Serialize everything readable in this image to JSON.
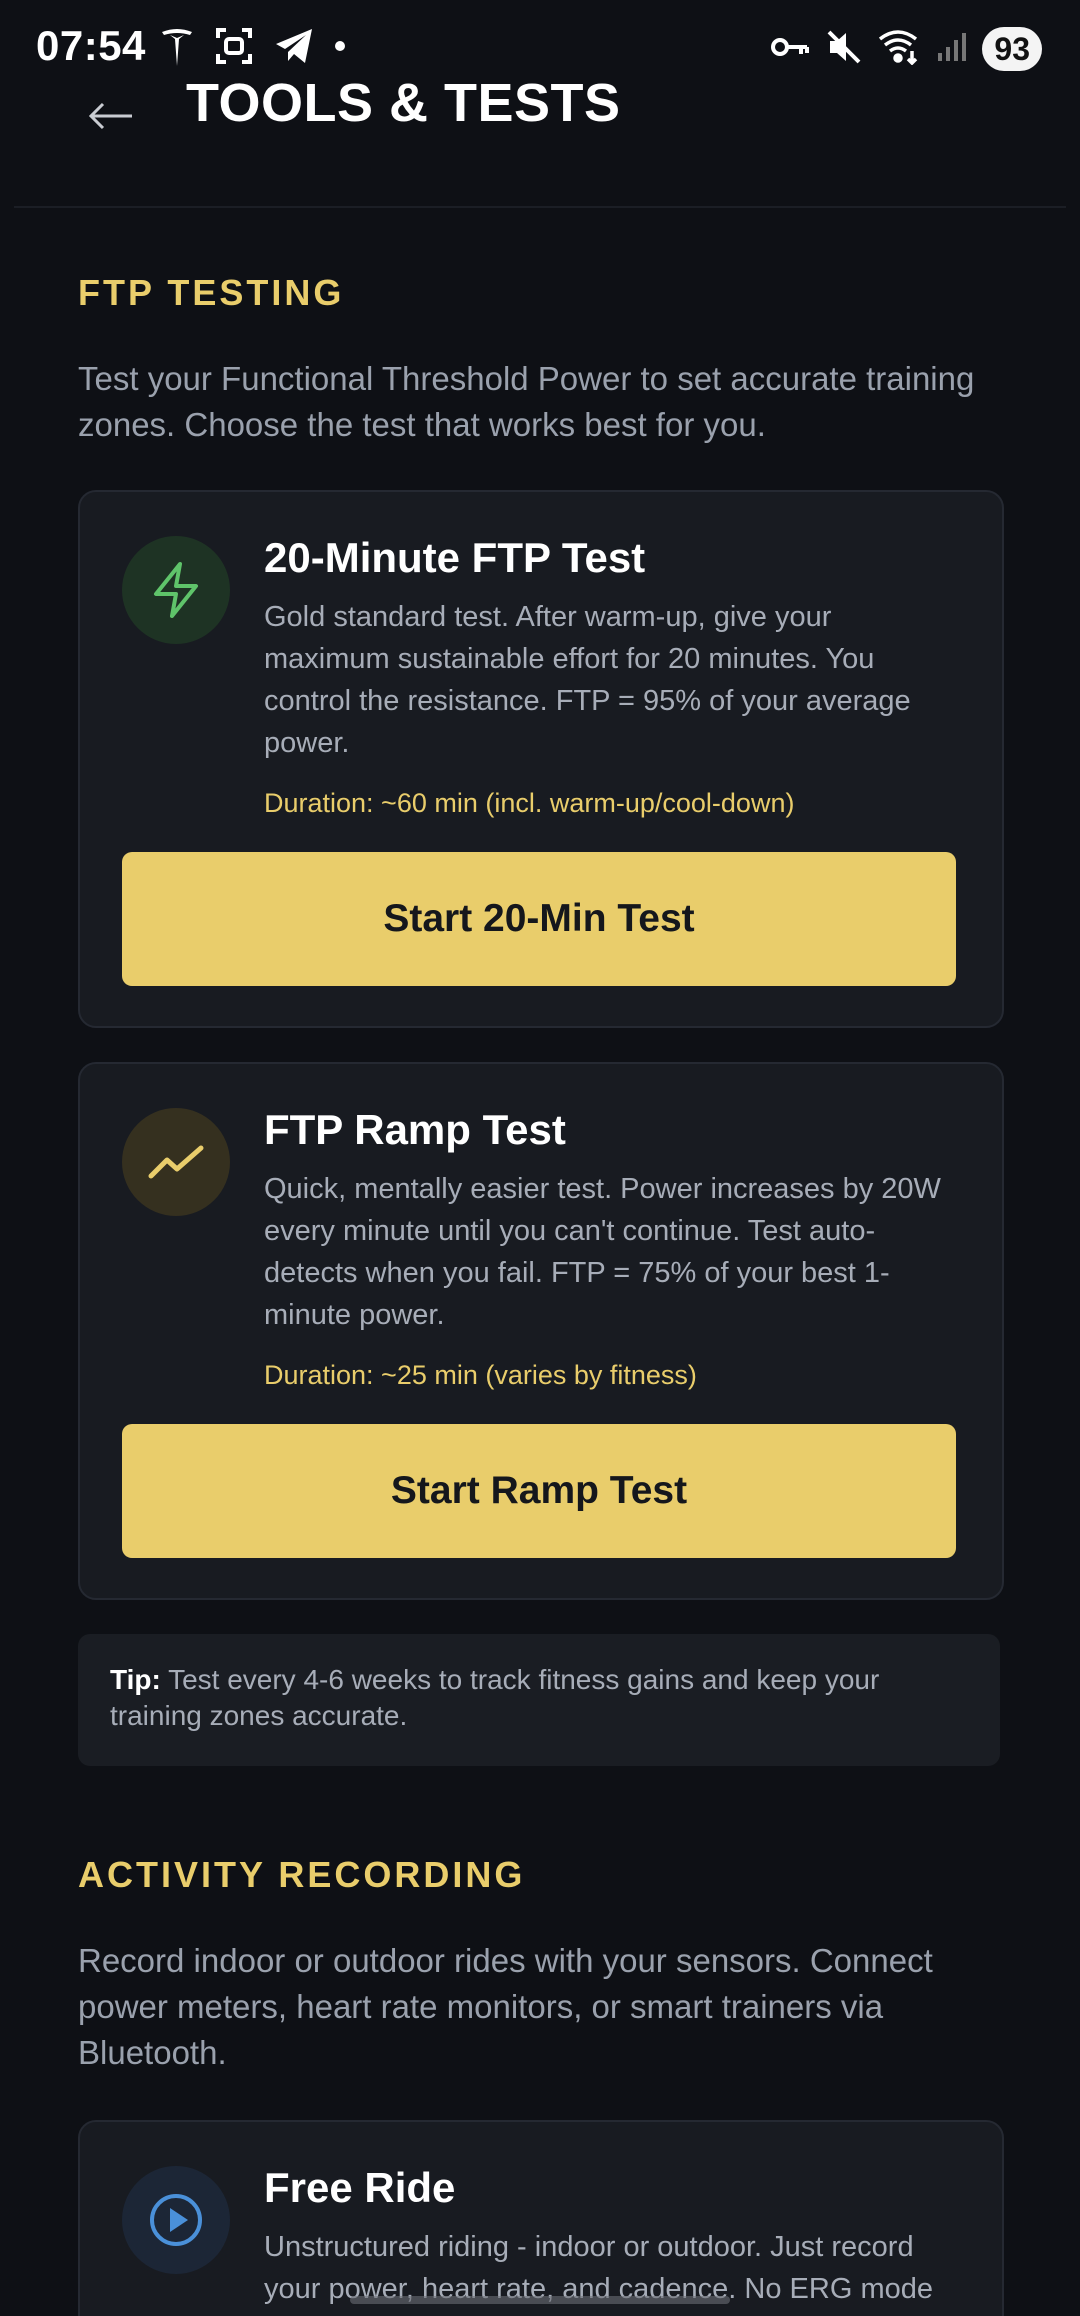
{
  "status_bar": {
    "time": "07:54",
    "battery": "93",
    "left_icons": [
      "tesla-icon",
      "face-scan-icon",
      "telegram-icon",
      "dot-icon"
    ],
    "right_icons": [
      "vpn-key-icon",
      "mute-icon",
      "wifi-icon",
      "signal-icon"
    ]
  },
  "header": {
    "title": "TOOLS & TESTS",
    "back_icon": "arrow-left-icon"
  },
  "ftp_section": {
    "title": "FTP TESTING",
    "description": "Test your Functional Threshold Power to set accurate training zones. Choose the test that works best for you.",
    "cards": [
      {
        "icon": "lightning-icon",
        "icon_color": "#5fc46a",
        "title": "20-Minute FTP Test",
        "description": "Gold standard test. After warm-up, give your maximum sustainable effort for 20 minutes. You control the resistance. FTP = 95% of your average power.",
        "duration": "Duration: ~60 min (incl. warm-up/cool-down)",
        "button_label": "Start 20-Min Test"
      },
      {
        "icon": "trend-up-icon",
        "icon_color": "#e9cd6b",
        "title": "FTP Ramp Test",
        "description": "Quick, mentally easier test. Power increases by 20W every minute until you can't continue. Test auto-detects when you fail. FTP = 75% of your best 1-minute power.",
        "duration": "Duration: ~25 min (varies by fitness)",
        "button_label": "Start Ramp Test"
      }
    ],
    "tip": {
      "label": "Tip:",
      "text": " Test every 4-6 weeks to track fitness gains and keep your training zones accurate."
    }
  },
  "activity_section": {
    "title": "ACTIVITY RECORDING",
    "description": "Record indoor or outdoor rides with your sensors. Connect power meters, heart rate monitors, or smart trainers via Bluetooth.",
    "cards": [
      {
        "icon": "play-circle-icon",
        "icon_color": "#4a90d9",
        "title": "Free Ride",
        "description": "Unstructured riding - indoor or outdoor. Just record your power, heart rate, and cadence. No ERG mode"
      }
    ]
  },
  "colors": {
    "background": "#0e1015",
    "card": "#181b21",
    "accent": "#e9cd6b",
    "text_muted": "#9aa1ad"
  }
}
